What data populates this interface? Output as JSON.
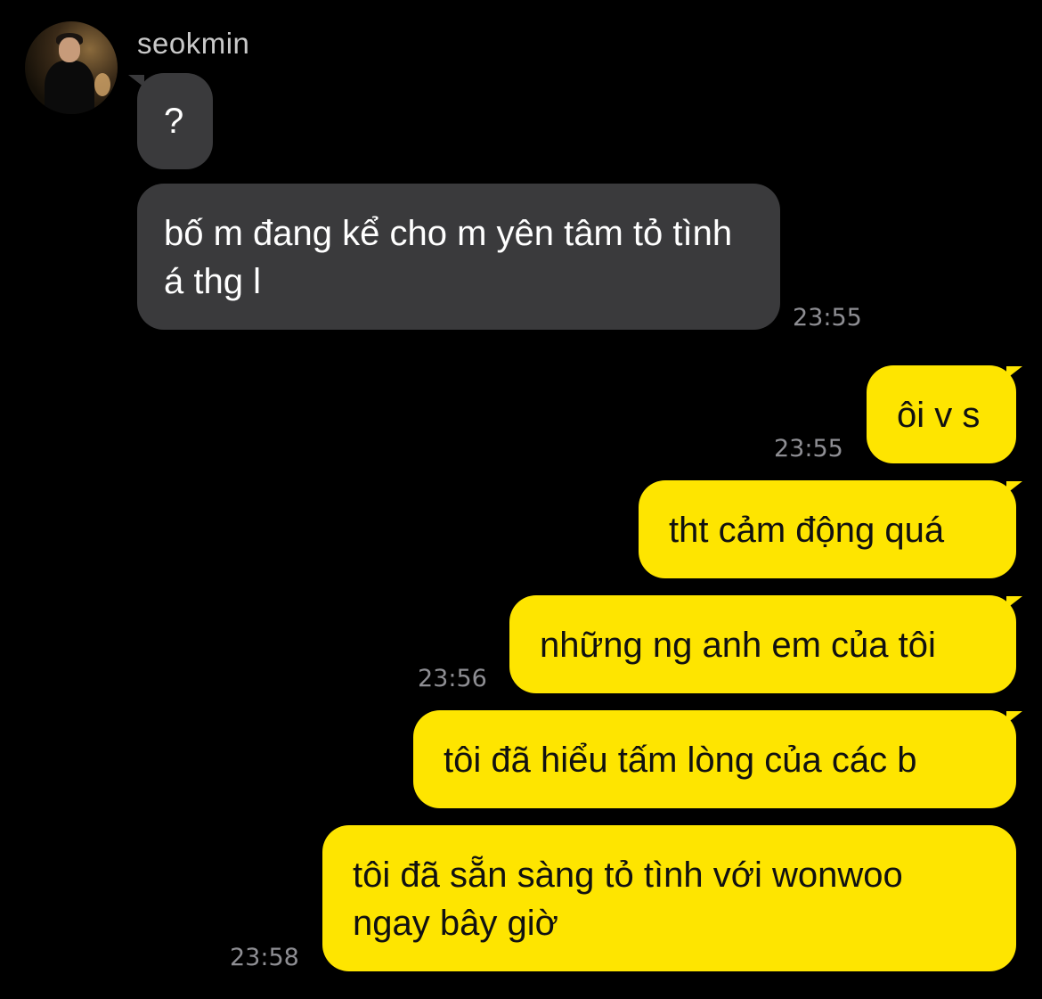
{
  "conversation": {
    "sender_name": "seokmin",
    "avatar_icon": "profile-photo",
    "colors": {
      "background": "#000000",
      "incoming_bubble": "#3a3a3c",
      "outgoing_bubble": "#fee500",
      "timestamp": "#8e8e93"
    }
  },
  "messages": [
    {
      "id": "m1",
      "direction": "incoming",
      "text": "?"
    },
    {
      "id": "m2",
      "direction": "incoming",
      "text": "bố m đang kể cho m yên tâm tỏ tình á thg l",
      "time": "23:55"
    },
    {
      "id": "m3",
      "direction": "outgoing",
      "text": "ôi v s",
      "time": "23:55"
    },
    {
      "id": "m4",
      "direction": "outgoing",
      "text": "tht cảm động quá"
    },
    {
      "id": "m5",
      "direction": "outgoing",
      "text": "những ng anh em của tôi",
      "time": "23:56"
    },
    {
      "id": "m6",
      "direction": "outgoing",
      "text": "tôi đã hiểu tấm lòng của các b"
    },
    {
      "id": "m7",
      "direction": "outgoing",
      "text": "tôi đã sẵn sàng tỏ tình với wonwoo ngay bây giờ",
      "time": "23:58"
    }
  ]
}
